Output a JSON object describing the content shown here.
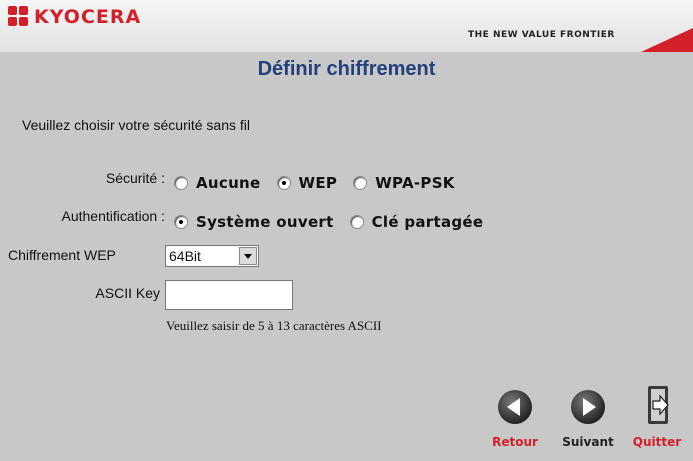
{
  "header": {
    "logo_text": "KYOCERA",
    "tagline": "THE NEW VALUE FRONTIER"
  },
  "page": {
    "title": "Définir chiffrement",
    "prompt": "Veuillez choisir votre sécurité sans fil"
  },
  "security": {
    "label": "Sécurité :",
    "options": [
      "Aucune",
      "WEP",
      "WPA-PSK"
    ],
    "selected": "WEP"
  },
  "authentication": {
    "label": "Authentification :",
    "options": [
      "Système ouvert",
      "Clé partagée"
    ],
    "selected": "Système ouvert"
  },
  "encryption": {
    "label": "Chiffrement WEP",
    "selected_value": "64Bit"
  },
  "ascii_key": {
    "label": "ASCII Key",
    "value": "",
    "hint": "Veuillez saisir de 5 à 13 caractères ASCII"
  },
  "nav": {
    "back_label": "Retour",
    "next_label": "Suivant",
    "quit_label": "Quitter"
  },
  "colors": {
    "brand_red": "#d31f2a",
    "title_blue": "#24407a",
    "background_gray": "#c8c8c8"
  }
}
